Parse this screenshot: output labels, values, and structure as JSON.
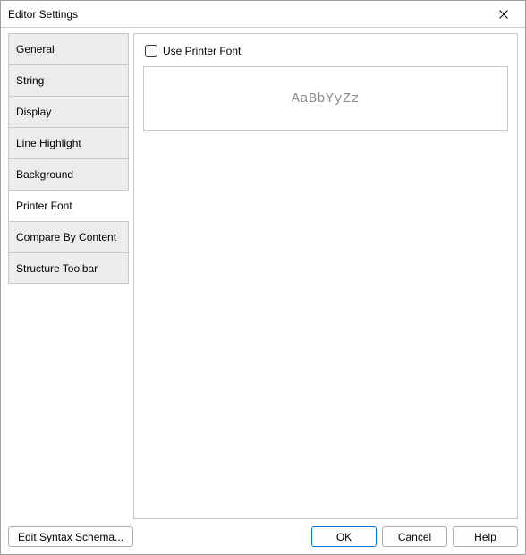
{
  "window": {
    "title": "Editor Settings"
  },
  "sidebar": {
    "tabs": [
      {
        "label": "General"
      },
      {
        "label": "String"
      },
      {
        "label": "Display"
      },
      {
        "label": "Line Highlight"
      },
      {
        "label": "Background"
      },
      {
        "label": "Printer Font"
      },
      {
        "label": "Compare By Content"
      },
      {
        "label": "Structure Toolbar"
      }
    ],
    "selected_index": 5
  },
  "content": {
    "use_printer_font_label": "Use Printer Font",
    "use_printer_font_checked": false,
    "preview_text": "AaBbYyZz"
  },
  "buttons": {
    "edit_syntax": "Edit Syntax Schema...",
    "ok": "OK",
    "cancel": "Cancel",
    "help_prefix": "H",
    "help_rest": "elp"
  }
}
